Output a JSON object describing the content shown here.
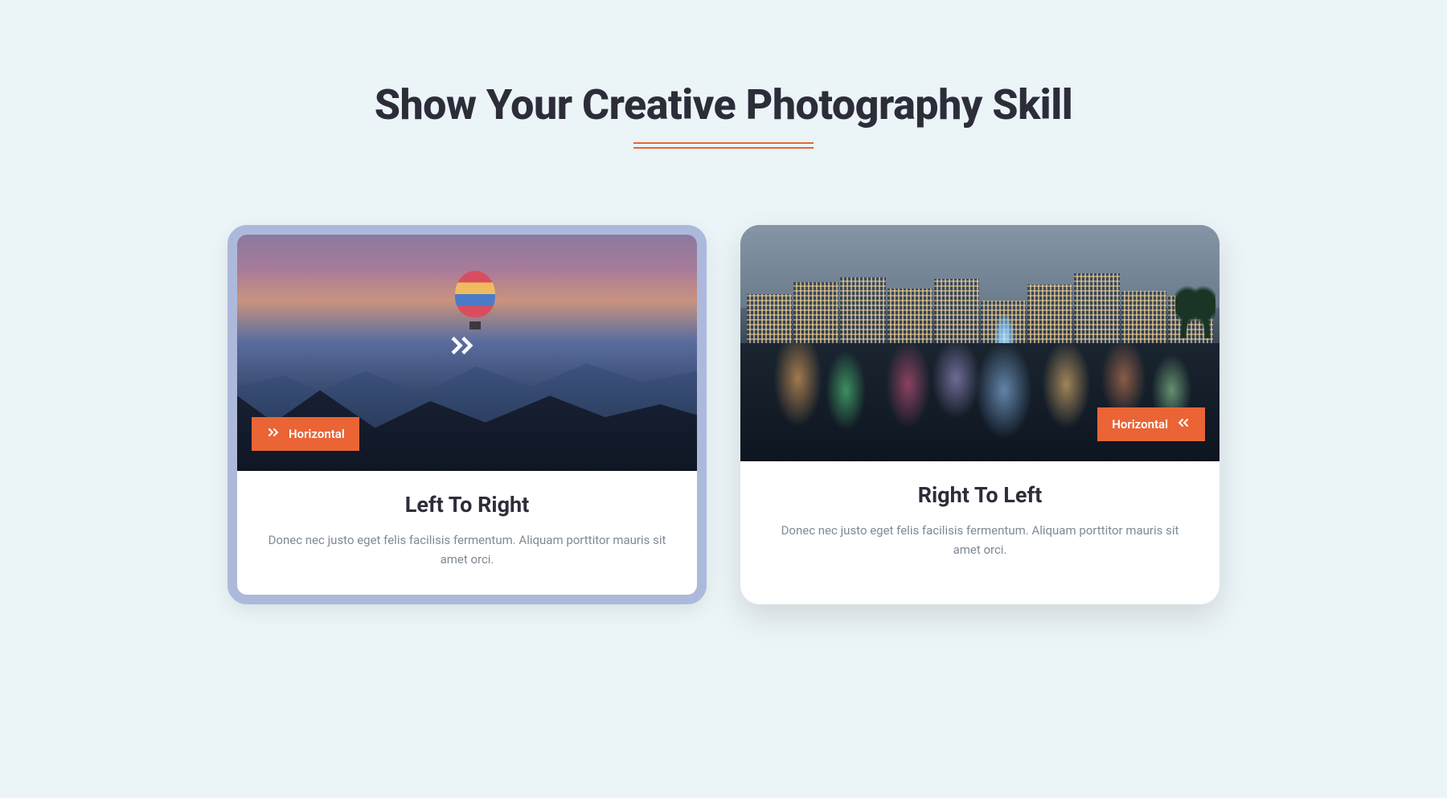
{
  "header": {
    "title": "Show Your Creative Photography Skill"
  },
  "cards": [
    {
      "badge_label": "Horizontal",
      "title": "Left To Right",
      "description": "Donec nec justo eget felis facilisis fermentum. Aliquam porttitor mauris sit amet orci."
    },
    {
      "badge_label": "Horizontal",
      "title": "Right To Left",
      "description": "Donec nec justo eget felis facilisis fermentum. Aliquam porttitor mauris sit amet orci."
    }
  ]
}
